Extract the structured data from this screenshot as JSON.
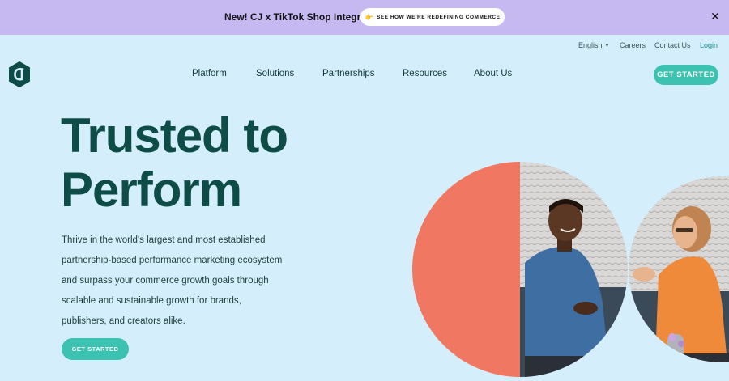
{
  "banner": {
    "text": "New! CJ x TikTok Shop Integration",
    "cta_icon": "pointing-hand-icon",
    "cta_label": "SEE HOW WE'RE REDEFINING COMMERCE",
    "close_icon": "close-icon",
    "close_label": "✕",
    "background": "#c6b9f1"
  },
  "utility_nav": {
    "language": "English",
    "careers": "Careers",
    "contact": "Contact Us",
    "login": "Login"
  },
  "logo": {
    "text": "CJ"
  },
  "main_nav": {
    "items": [
      "Platform",
      "Solutions",
      "Partnerships",
      "Resources",
      "About Us"
    ],
    "cta": "GET STARTED"
  },
  "hero": {
    "title_line1": "Trusted to",
    "title_line2": "Perform",
    "body": "Thrive in the world's largest and most established partnership-based performance marketing ecosystem and surpass your commerce growth goals through scalable and sustainable growth for brands, publishers, and creators alike.",
    "cta": "GET STARTED"
  },
  "colors": {
    "page_background": "#d5eefb",
    "accent": "#3bc2b0",
    "heading": "#0e4c47",
    "coral": "#f07761"
  }
}
